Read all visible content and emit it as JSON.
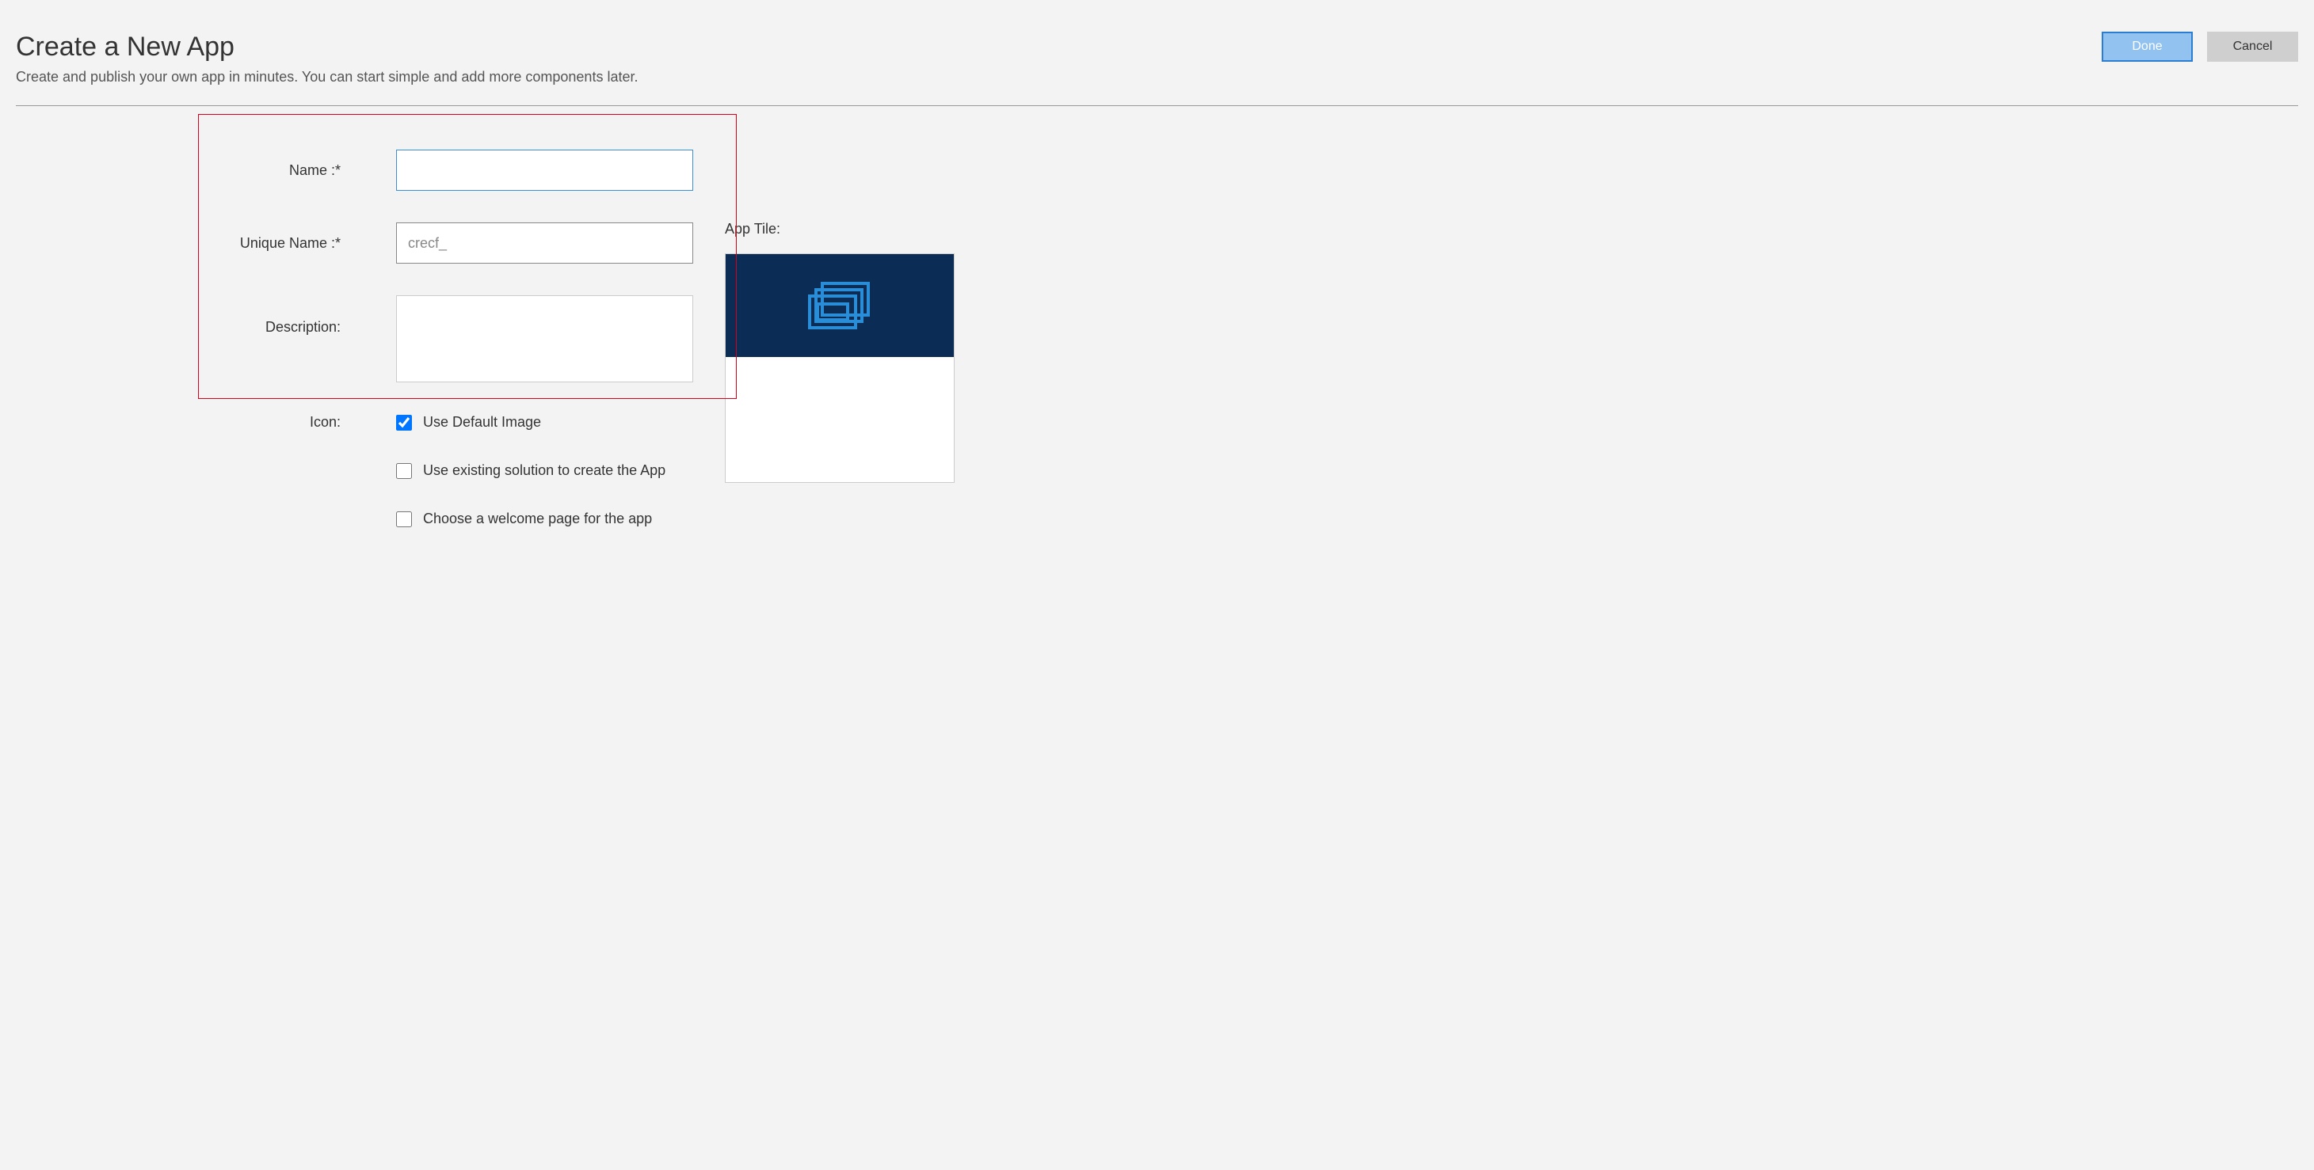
{
  "header": {
    "title": "Create a New App",
    "subtitle": "Create and publish your own app in minutes. You can start simple and add more components later.",
    "done_label": "Done",
    "cancel_label": "Cancel"
  },
  "form": {
    "name_label": "Name :*",
    "name_value": "",
    "unique_name_label": "Unique Name :*",
    "unique_name_value": "crecf_",
    "description_label": "Description:",
    "description_value": "",
    "icon_label": "Icon:",
    "use_default_image_label": "Use Default Image",
    "use_default_image_checked": true,
    "use_existing_label": "Use existing solution to create the App",
    "use_existing_checked": false,
    "welcome_page_label": "Choose a welcome page for the app",
    "welcome_page_checked": false
  },
  "tile": {
    "label": "App Tile:"
  }
}
